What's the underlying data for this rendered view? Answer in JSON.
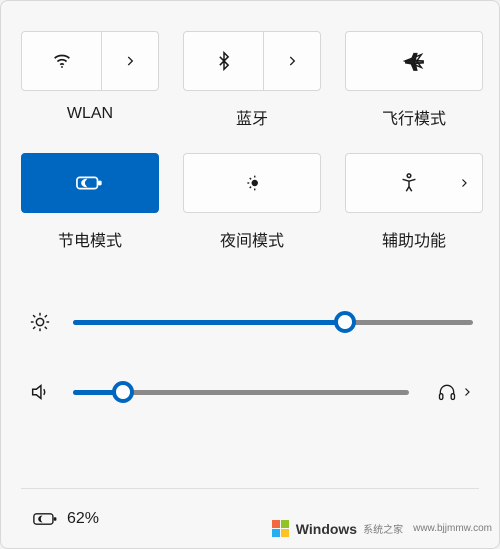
{
  "tiles": {
    "wlan": {
      "label": "WLAN",
      "active": false,
      "has_arrow": true
    },
    "bt": {
      "label": "蓝牙",
      "active": false,
      "has_arrow": true
    },
    "air": {
      "label": "飞行模式",
      "active": false,
      "has_arrow": false
    },
    "saver": {
      "label": "节电模式",
      "active": true,
      "has_arrow": false
    },
    "night": {
      "label": "夜间模式",
      "active": false,
      "has_arrow": false
    },
    "access": {
      "label": "辅助功能",
      "active": false,
      "has_arrow": true
    }
  },
  "sliders": {
    "brightness": {
      "value": 68
    },
    "volume": {
      "value": 15,
      "output_device_expandable": true
    }
  },
  "status": {
    "battery_percent_text": "62%"
  },
  "watermark": {
    "brand": "Windows",
    "subtitle": "系统之家",
    "url": "www.bjjmmw.com"
  },
  "colors": {
    "accent": "#0067c0"
  }
}
